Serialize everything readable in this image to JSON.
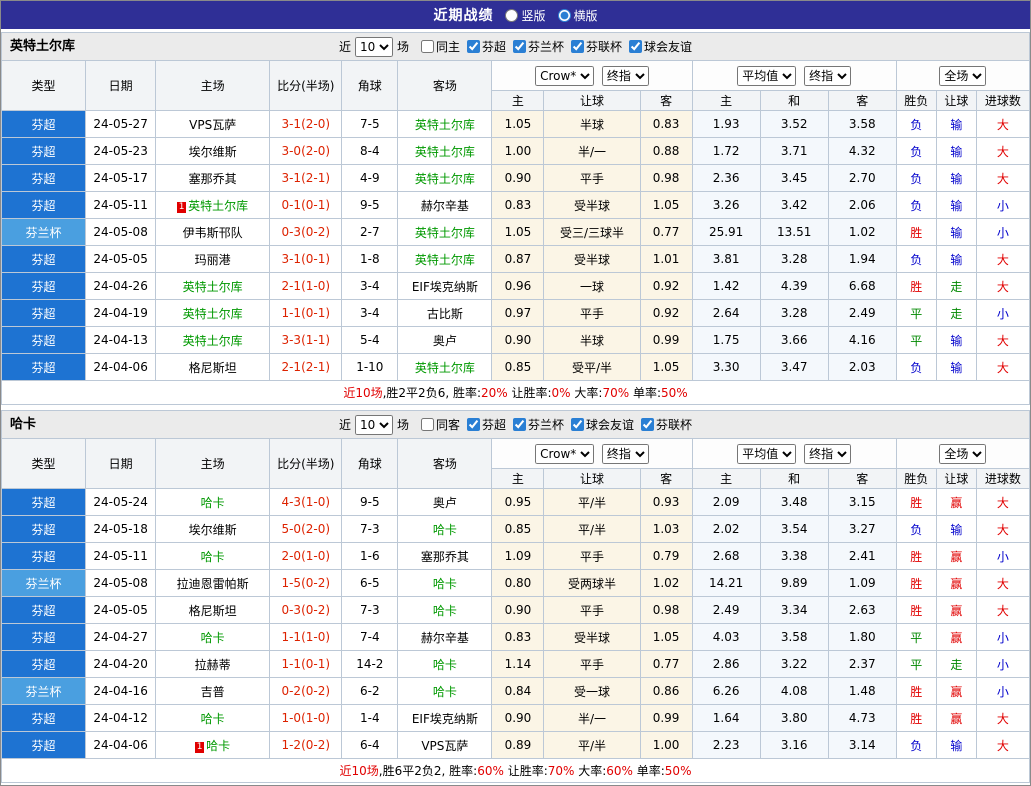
{
  "topbar": {
    "title": "近期战绩",
    "radios": [
      {
        "label": "竖版",
        "selected": false
      },
      {
        "label": "横版",
        "selected": true
      }
    ]
  },
  "table_headers": {
    "type": "类型",
    "date": "日期",
    "home": "主场",
    "score": "比分(半场)",
    "corners": "角球",
    "away": "客场",
    "sub": [
      "主",
      "让球",
      "客",
      "主",
      "和",
      "客",
      "胜负",
      "让球",
      "进球数"
    ]
  },
  "league_classes": {
    "芬超": "lg-super",
    "芬兰杯": "lg-cup"
  },
  "result_colors": {
    "胜": "r-red",
    "赢": "r-red",
    "大": "r-red",
    "平": "r-green",
    "走": "r-green",
    "负": "r-blue",
    "输": "r-blue",
    "小": "r-blue"
  },
  "colors": {
    "accent_blue": "#2f2f96",
    "league_super": "#1e73d2",
    "league_cup": "#4a9fe0",
    "focus_green": "#009900",
    "score_red": "#dd2200",
    "result_red": "#e10000",
    "result_green": "#008800",
    "result_blue": "#0000cc"
  },
  "sections": [
    {
      "team": "英特土尔库",
      "controls": {
        "near_label": "近",
        "rounds": "10",
        "matches_label": "场",
        "filters": [
          {
            "label": "同主",
            "checked": false
          },
          {
            "label": "芬超",
            "checked": true
          },
          {
            "label": "芬兰杯",
            "checked": true
          },
          {
            "label": "芬联杯",
            "checked": true
          },
          {
            "label": "球会友谊",
            "checked": true
          }
        ],
        "bookmaker": "Crow*",
        "ah_index": "终指",
        "euro_avg": "平均值",
        "euro_index": "终指",
        "scope": "全场"
      },
      "rows": [
        {
          "league": "芬超",
          "date": "24-05-27",
          "home": "VPS瓦萨",
          "home_focus": false,
          "home_card": "",
          "score": "3-1(2-0)",
          "corners": "7-5",
          "away": "英特土尔库",
          "away_focus": true,
          "away_card": "",
          "ah_home": "1.05",
          "ah_line": "半球",
          "ah_away": "0.83",
          "o_home": "1.93",
          "o_draw": "3.52",
          "o_away": "3.58",
          "wdl": "负",
          "ah": "输",
          "ou": "大"
        },
        {
          "league": "芬超",
          "date": "24-05-23",
          "home": "埃尔维斯",
          "home_focus": false,
          "home_card": "",
          "score": "3-0(2-0)",
          "corners": "8-4",
          "away": "英特土尔库",
          "away_focus": true,
          "away_card": "",
          "ah_home": "1.00",
          "ah_line": "半/一",
          "ah_away": "0.88",
          "o_home": "1.72",
          "o_draw": "3.71",
          "o_away": "4.32",
          "wdl": "负",
          "ah": "输",
          "ou": "大"
        },
        {
          "league": "芬超",
          "date": "24-05-17",
          "home": "塞那乔其",
          "home_focus": false,
          "home_card": "",
          "score": "3-1(2-1)",
          "corners": "4-9",
          "away": "英特土尔库",
          "away_focus": true,
          "away_card": "",
          "ah_home": "0.90",
          "ah_line": "平手",
          "ah_away": "0.98",
          "o_home": "2.36",
          "o_draw": "3.45",
          "o_away": "2.70",
          "wdl": "负",
          "ah": "输",
          "ou": "大"
        },
        {
          "league": "芬超",
          "date": "24-05-11",
          "home": "英特土尔库",
          "home_focus": true,
          "home_card": "1",
          "score": "0-1(0-1)",
          "corners": "9-5",
          "away": "赫尔辛基",
          "away_focus": false,
          "away_card": "",
          "ah_home": "0.83",
          "ah_line": "受半球",
          "ah_away": "1.05",
          "o_home": "3.26",
          "o_draw": "3.42",
          "o_away": "2.06",
          "wdl": "负",
          "ah": "输",
          "ou": "小"
        },
        {
          "league": "芬兰杯",
          "date": "24-05-08",
          "home": "伊韦斯邗队",
          "home_focus": false,
          "home_card": "",
          "score": "0-3(0-2)",
          "corners": "2-7",
          "away": "英特土尔库",
          "away_focus": true,
          "away_card": "",
          "ah_home": "1.05",
          "ah_line": "受三/三球半",
          "ah_away": "0.77",
          "o_home": "25.91",
          "o_draw": "13.51",
          "o_away": "1.02",
          "wdl": "胜",
          "ah": "输",
          "ou": "小"
        },
        {
          "league": "芬超",
          "date": "24-05-05",
          "home": "玛丽港",
          "home_focus": false,
          "home_card": "",
          "score": "3-1(0-1)",
          "corners": "1-8",
          "away": "英特土尔库",
          "away_focus": true,
          "away_card": "",
          "ah_home": "0.87",
          "ah_line": "受半球",
          "ah_away": "1.01",
          "o_home": "3.81",
          "o_draw": "3.28",
          "o_away": "1.94",
          "wdl": "负",
          "ah": "输",
          "ou": "大"
        },
        {
          "league": "芬超",
          "date": "24-04-26",
          "home": "英特土尔库",
          "home_focus": true,
          "home_card": "",
          "score": "2-1(1-0)",
          "corners": "3-4",
          "away": "EIF埃克纳斯",
          "away_focus": false,
          "away_card": "",
          "ah_home": "0.96",
          "ah_line": "一球",
          "ah_away": "0.92",
          "o_home": "1.42",
          "o_draw": "4.39",
          "o_away": "6.68",
          "wdl": "胜",
          "ah": "走",
          "ou": "大"
        },
        {
          "league": "芬超",
          "date": "24-04-19",
          "home": "英特土尔库",
          "home_focus": true,
          "home_card": "",
          "score": "1-1(0-1)",
          "corners": "3-4",
          "away": "古比斯",
          "away_focus": false,
          "away_card": "",
          "ah_home": "0.97",
          "ah_line": "平手",
          "ah_away": "0.92",
          "o_home": "2.64",
          "o_draw": "3.28",
          "o_away": "2.49",
          "wdl": "平",
          "ah": "走",
          "ou": "小"
        },
        {
          "league": "芬超",
          "date": "24-04-13",
          "home": "英特土尔库",
          "home_focus": true,
          "home_card": "",
          "score": "3-3(1-1)",
          "corners": "5-4",
          "away": "奥卢",
          "away_focus": false,
          "away_card": "",
          "ah_home": "0.90",
          "ah_line": "半球",
          "ah_away": "0.99",
          "o_home": "1.75",
          "o_draw": "3.66",
          "o_away": "4.16",
          "wdl": "平",
          "ah": "输",
          "ou": "大"
        },
        {
          "league": "芬超",
          "date": "24-04-06",
          "home": "格尼斯坦",
          "home_focus": false,
          "home_card": "",
          "score": "2-1(2-1)",
          "corners": "1-10",
          "away": "英特土尔库",
          "away_focus": true,
          "away_card": "",
          "ah_home": "0.85",
          "ah_line": "受平/半",
          "ah_away": "1.05",
          "o_home": "3.30",
          "o_draw": "3.47",
          "o_away": "2.03",
          "wdl": "负",
          "ah": "输",
          "ou": "大"
        }
      ],
      "summary": {
        "prefix": "近10场",
        "record": ",胜2平2负6, ",
        "stats": [
          {
            "label": "胜率:",
            "value": "20%"
          },
          {
            "label": " 让胜率:",
            "value": "0%"
          },
          {
            "label": " 大率:",
            "value": "70%"
          },
          {
            "label": " 单率:",
            "value": "50%"
          }
        ]
      }
    },
    {
      "team": "哈卡",
      "controls": {
        "near_label": "近",
        "rounds": "10",
        "matches_label": "场",
        "filters": [
          {
            "label": "同客",
            "checked": false
          },
          {
            "label": "芬超",
            "checked": true
          },
          {
            "label": "芬兰杯",
            "checked": true
          },
          {
            "label": "球会友谊",
            "checked": true
          },
          {
            "label": "芬联杯",
            "checked": true
          }
        ],
        "bookmaker": "Crow*",
        "ah_index": "终指",
        "euro_avg": "平均值",
        "euro_index": "终指",
        "scope": "全场"
      },
      "rows": [
        {
          "league": "芬超",
          "date": "24-05-24",
          "home": "哈卡",
          "home_focus": true,
          "home_card": "",
          "score": "4-3(1-0)",
          "corners": "9-5",
          "away": "奥卢",
          "away_focus": false,
          "away_card": "",
          "ah_home": "0.95",
          "ah_line": "平/半",
          "ah_away": "0.93",
          "o_home": "2.09",
          "o_draw": "3.48",
          "o_away": "3.15",
          "wdl": "胜",
          "ah": "赢",
          "ou": "大"
        },
        {
          "league": "芬超",
          "date": "24-05-18",
          "home": "埃尔维斯",
          "home_focus": false,
          "home_card": "",
          "score": "5-0(2-0)",
          "corners": "7-3",
          "away": "哈卡",
          "away_focus": true,
          "away_card": "",
          "ah_home": "0.85",
          "ah_line": "平/半",
          "ah_away": "1.03",
          "o_home": "2.02",
          "o_draw": "3.54",
          "o_away": "3.27",
          "wdl": "负",
          "ah": "输",
          "ou": "大"
        },
        {
          "league": "芬超",
          "date": "24-05-11",
          "home": "哈卡",
          "home_focus": true,
          "home_card": "",
          "score": "2-0(1-0)",
          "corners": "1-6",
          "away": "塞那乔其",
          "away_focus": false,
          "away_card": "",
          "ah_home": "1.09",
          "ah_line": "平手",
          "ah_away": "0.79",
          "o_home": "2.68",
          "o_draw": "3.38",
          "o_away": "2.41",
          "wdl": "胜",
          "ah": "赢",
          "ou": "小"
        },
        {
          "league": "芬兰杯",
          "date": "24-05-08",
          "home": "拉迪恩雷帕斯",
          "home_focus": false,
          "home_card": "",
          "score": "1-5(0-2)",
          "corners": "6-5",
          "away": "哈卡",
          "away_focus": true,
          "away_card": "",
          "ah_home": "0.80",
          "ah_line": "受两球半",
          "ah_away": "1.02",
          "o_home": "14.21",
          "o_draw": "9.89",
          "o_away": "1.09",
          "wdl": "胜",
          "ah": "赢",
          "ou": "大"
        },
        {
          "league": "芬超",
          "date": "24-05-05",
          "home": "格尼斯坦",
          "home_focus": false,
          "home_card": "",
          "score": "0-3(0-2)",
          "corners": "7-3",
          "away": "哈卡",
          "away_focus": true,
          "away_card": "",
          "ah_home": "0.90",
          "ah_line": "平手",
          "ah_away": "0.98",
          "o_home": "2.49",
          "o_draw": "3.34",
          "o_away": "2.63",
          "wdl": "胜",
          "ah": "赢",
          "ou": "大"
        },
        {
          "league": "芬超",
          "date": "24-04-27",
          "home": "哈卡",
          "home_focus": true,
          "home_card": "",
          "score": "1-1(1-0)",
          "corners": "7-4",
          "away": "赫尔辛基",
          "away_focus": false,
          "away_card": "",
          "ah_home": "0.83",
          "ah_line": "受半球",
          "ah_away": "1.05",
          "o_home": "4.03",
          "o_draw": "3.58",
          "o_away": "1.80",
          "wdl": "平",
          "ah": "赢",
          "ou": "小"
        },
        {
          "league": "芬超",
          "date": "24-04-20",
          "home": "拉赫蒂",
          "home_focus": false,
          "home_card": "",
          "score": "1-1(0-1)",
          "corners": "14-2",
          "away": "哈卡",
          "away_focus": true,
          "away_card": "",
          "ah_home": "1.14",
          "ah_line": "平手",
          "ah_away": "0.77",
          "o_home": "2.86",
          "o_draw": "3.22",
          "o_away": "2.37",
          "wdl": "平",
          "ah": "走",
          "ou": "小"
        },
        {
          "league": "芬兰杯",
          "date": "24-04-16",
          "home": "吉普",
          "home_focus": false,
          "home_card": "",
          "score": "0-2(0-2)",
          "corners": "6-2",
          "away": "哈卡",
          "away_focus": true,
          "away_card": "",
          "ah_home": "0.84",
          "ah_line": "受一球",
          "ah_away": "0.86",
          "o_home": "6.26",
          "o_draw": "4.08",
          "o_away": "1.48",
          "wdl": "胜",
          "ah": "赢",
          "ou": "小"
        },
        {
          "league": "芬超",
          "date": "24-04-12",
          "home": "哈卡",
          "home_focus": true,
          "home_card": "",
          "score": "1-0(1-0)",
          "corners": "1-4",
          "away": "EIF埃克纳斯",
          "away_focus": false,
          "away_card": "",
          "ah_home": "0.90",
          "ah_line": "半/一",
          "ah_away": "0.99",
          "o_home": "1.64",
          "o_draw": "3.80",
          "o_away": "4.73",
          "wdl": "胜",
          "ah": "赢",
          "ou": "大"
        },
        {
          "league": "芬超",
          "date": "24-04-06",
          "home": "哈卡",
          "home_focus": true,
          "home_card": "1",
          "score": "1-2(0-2)",
          "corners": "6-4",
          "away": "VPS瓦萨",
          "away_focus": false,
          "away_card": "",
          "ah_home": "0.89",
          "ah_line": "平/半",
          "ah_away": "1.00",
          "o_home": "2.23",
          "o_draw": "3.16",
          "o_away": "3.14",
          "wdl": "负",
          "ah": "输",
          "ou": "大"
        }
      ],
      "summary": {
        "prefix": "近10场",
        "record": ",胜6平2负2, ",
        "stats": [
          {
            "label": "胜率:",
            "value": "60%"
          },
          {
            "label": " 让胜率:",
            "value": "70%"
          },
          {
            "label": " 大率:",
            "value": "60%"
          },
          {
            "label": " 单率:",
            "value": "50%"
          }
        ]
      }
    }
  ]
}
